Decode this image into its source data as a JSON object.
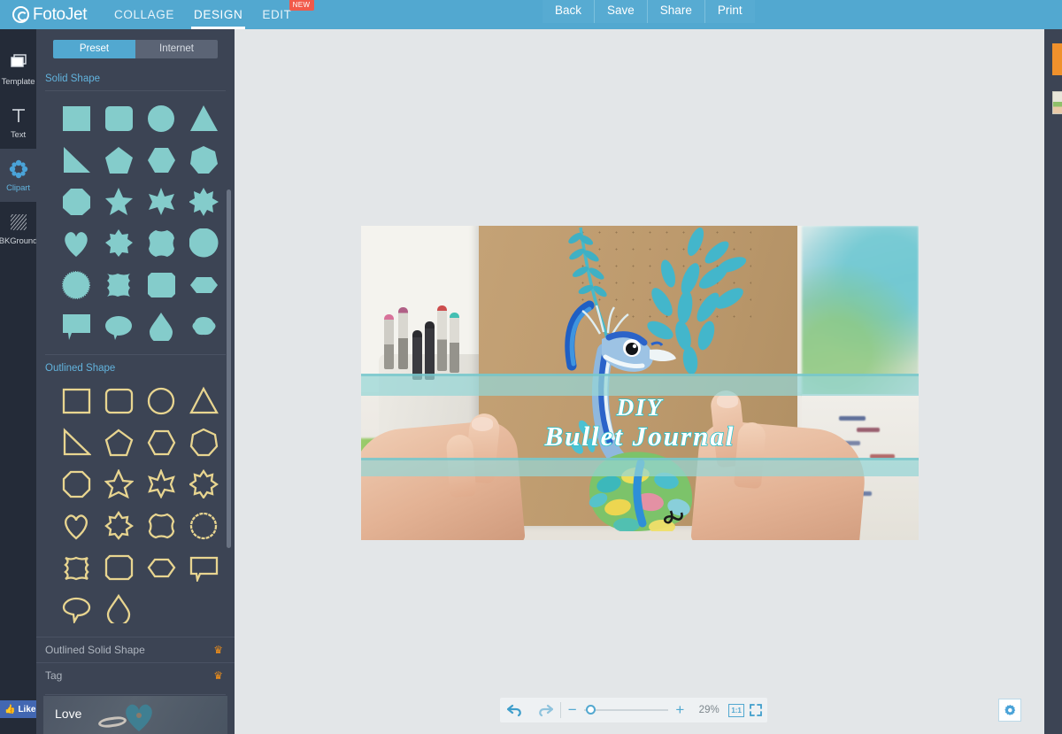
{
  "app": {
    "brand": "FotoJet",
    "logo_icon": "spiral-logo-icon",
    "header_color": "#52a8d0"
  },
  "header": {
    "nav": [
      {
        "label": "COLLAGE",
        "active": false
      },
      {
        "label": "DESIGN",
        "active": true
      },
      {
        "label": "EDIT",
        "active": false,
        "badge": "NEW"
      }
    ],
    "actions": [
      {
        "label": "Back",
        "icon": "back-action"
      },
      {
        "label": "Save",
        "icon": "save-action"
      },
      {
        "label": "Share",
        "icon": "share-action"
      },
      {
        "label": "Print",
        "icon": "print-action"
      }
    ]
  },
  "rail": {
    "items": [
      {
        "label": "Template",
        "icon": "layers-icon",
        "active": false
      },
      {
        "label": "Text",
        "icon": "text-t-icon",
        "active": false
      },
      {
        "label": "Clipart",
        "icon": "gear-flower-icon",
        "active": true
      },
      {
        "label": "BKGround",
        "icon": "hatch-pattern-icon",
        "active": false
      }
    ]
  },
  "panel": {
    "tabs": [
      {
        "label": "Preset",
        "active": true
      },
      {
        "label": "Internet",
        "active": false
      }
    ],
    "sections": [
      {
        "title": "Solid Shape",
        "style": "solid",
        "fill": "#84cccb",
        "shapes": [
          "square",
          "rounded-square",
          "circle",
          "triangle",
          "right-triangle",
          "pentagon",
          "hexagon",
          "heptagon",
          "octagon",
          "star-5",
          "star-6",
          "star-8",
          "heart",
          "scalloped-star-square",
          "scalloped-octagon",
          "scalloped-circle",
          "starburst-circle",
          "concave-square",
          "notched-square",
          "flat-hexagon",
          "speech-box",
          "speech-ellipse",
          "teardrop",
          "speech-cloud"
        ]
      },
      {
        "title": "Outlined Shape",
        "style": "outline",
        "stroke": "#e8d590",
        "shapes": [
          "square",
          "rounded-square",
          "circle",
          "triangle",
          "right-triangle",
          "pentagon",
          "hexagon",
          "heptagon",
          "octagon",
          "star-5",
          "star-6",
          "star-8",
          "heart",
          "scalloped-star-square",
          "scalloped-octagon",
          "scalloped-circle",
          "concave-square",
          "notched-square",
          "flat-hexagon",
          "speech-box",
          "speech-ellipse",
          "teardrop"
        ]
      }
    ],
    "locked_rows": [
      {
        "label": "Outlined Solid Shape",
        "badge_icon": "crown-icon",
        "badge_color": "#f39019"
      },
      {
        "label": "Tag",
        "badge_icon": "crown-icon",
        "badge_color": "#f39019"
      }
    ],
    "featured": {
      "label": "Love",
      "thumb_icon": "heart-ring-photo"
    },
    "scrollbar": {
      "present": true
    }
  },
  "social": {
    "like_label": "Like",
    "like_icon": "thumbs-up-icon",
    "like_color": "#4267b2"
  },
  "canvas": {
    "title_line_1": "DIY",
    "title_line_2": "Bullet Journal",
    "title_fill": "#ffffff",
    "title_outline": "#29c4cf",
    "banner_color": "#96d6d6",
    "photo_description": "hands holding kraft paper journal with painted peacock"
  },
  "toolbar": {
    "undo_icon": "undo-arrow-icon",
    "redo_icon": "redo-arrow-icon",
    "zoom_out_label": "−",
    "zoom_in_label": "+",
    "zoom_value": "29%",
    "actual_size_label": "1:1",
    "fit_icon": "fullscreen-icon",
    "settings_icon": "gear-icon"
  },
  "right_panel": {
    "add_button_color": "#f0912c",
    "add_button_icon": "add-photo-button",
    "thumbs": 1
  }
}
